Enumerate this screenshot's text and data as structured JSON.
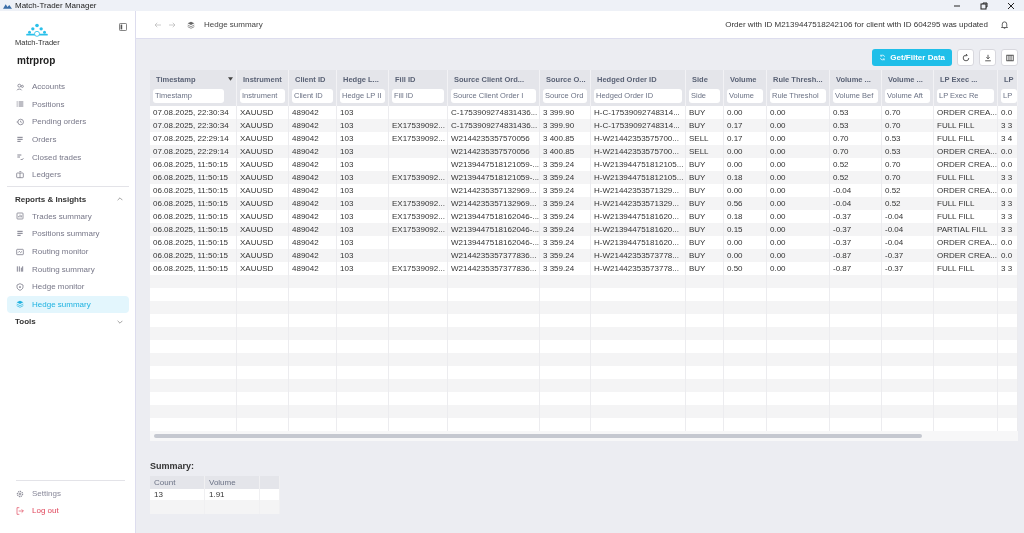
{
  "window": {
    "title": "Match-Trader Manager"
  },
  "sidebar": {
    "logo_text": "Match-Trader",
    "account": "mtrprop",
    "items": [
      {
        "label": "Accounts",
        "selected": false
      },
      {
        "label": "Positions",
        "selected": false
      },
      {
        "label": "Pending orders",
        "selected": false
      },
      {
        "label": "Orders",
        "selected": false
      },
      {
        "label": "Closed trades",
        "selected": false
      },
      {
        "label": "Ledgers",
        "selected": false
      }
    ],
    "sections": [
      {
        "label": "Reports & Insights",
        "expanded": true,
        "children": [
          {
            "label": "Trades summary",
            "selected": false
          },
          {
            "label": "Positions summary",
            "selected": false
          },
          {
            "label": "Routing monitor",
            "selected": false
          },
          {
            "label": "Routing summary",
            "selected": false
          },
          {
            "label": "Hedge monitor",
            "selected": false
          },
          {
            "label": "Hedge summary",
            "selected": true
          }
        ]
      },
      {
        "label": "Tools",
        "expanded": false
      }
    ],
    "footer": [
      {
        "label": "Settings",
        "kind": "settings"
      },
      {
        "label": "Log out",
        "kind": "logout"
      }
    ]
  },
  "topbar": {
    "breadcrumb": "Hedge summary",
    "notification": "Order with ID M2139447518242106 for client with ID 604295 was updated"
  },
  "toolbar": {
    "primary_button": "Get/Filter Data"
  },
  "table": {
    "columns": [
      {
        "label": "Timestamp",
        "placeholder": "Timestamp",
        "sorted": true
      },
      {
        "label": "Instrument",
        "placeholder": "Instrument",
        "sorted": false
      },
      {
        "label": "Client ID",
        "placeholder": "Client ID",
        "sorted": false
      },
      {
        "label": "Hedge L...",
        "placeholder": "Hedge LP II",
        "sorted": false
      },
      {
        "label": "Fill ID",
        "placeholder": "Fill ID",
        "sorted": false
      },
      {
        "label": "Source Client Ord...",
        "placeholder": "Source Client Order I",
        "sorted": false
      },
      {
        "label": "Source O...",
        "placeholder": "Source Ord",
        "sorted": false
      },
      {
        "label": "Hedged Order ID",
        "placeholder": "Hedged Order ID",
        "sorted": false
      },
      {
        "label": "Side",
        "placeholder": "Side",
        "sorted": false
      },
      {
        "label": "Volume",
        "placeholder": "Volume",
        "sorted": false
      },
      {
        "label": "Rule Thresh...",
        "placeholder": "Rule Threshol",
        "sorted": false
      },
      {
        "label": "Volume ...",
        "placeholder": "Volume Bef",
        "sorted": false
      },
      {
        "label": "Volume ...",
        "placeholder": "Volume Aft",
        "sorted": false
      },
      {
        "label": "LP Exec ...",
        "placeholder": "LP Exec Re",
        "sorted": false
      },
      {
        "label": "LP",
        "placeholder": "LP",
        "sorted": false
      }
    ],
    "rows": [
      [
        "07.08.2025, 22:30:34",
        "XAUUSD",
        "489042",
        "103",
        null,
        "C-1753909274831436...",
        "3 399.90",
        "H-C-17539092748314...",
        "BUY",
        "0.00",
        "0.00",
        "0.53",
        "0.70",
        "ORDER CREA...",
        "0.0"
      ],
      [
        "07.08.2025, 22:30:34",
        "XAUUSD",
        "489042",
        "103",
        "EX17539092...",
        "C-1753909274831436...",
        "3 399.90",
        "H-C-17539092748314...",
        "BUY",
        "0.17",
        "0.00",
        "0.53",
        "0.70",
        "FULL FILL",
        "3 3"
      ],
      [
        "07.08.2025, 22:29:14",
        "XAUUSD",
        "489042",
        "103",
        "EX17539092...",
        "W2144235357570056",
        "3 400.85",
        "H-W21442353575700...",
        "SELL",
        "0.17",
        "0.00",
        "0.70",
        "0.53",
        "FULL FILL",
        "3 4"
      ],
      [
        "07.08.2025, 22:29:14",
        "XAUUSD",
        "489042",
        "103",
        null,
        "W2144235357570056",
        "3 400.85",
        "H-W21442353575700...",
        "SELL",
        "0.00",
        "0.00",
        "0.70",
        "0.53",
        "ORDER CREA...",
        "0.0"
      ],
      [
        "06.08.2025, 11:50:15",
        "XAUUSD",
        "489042",
        "103",
        null,
        "W2139447518121059-...",
        "3 359.24",
        "H-W213944751812105...",
        "BUY",
        "0.00",
        "0.00",
        "0.52",
        "0.70",
        "ORDER CREA...",
        "0.0"
      ],
      [
        "06.08.2025, 11:50:15",
        "XAUUSD",
        "489042",
        "103",
        "EX17539092...",
        "W2139447518121059-...",
        "3 359.24",
        "H-W213944751812105...",
        "BUY",
        "0.18",
        "0.00",
        "0.52",
        "0.70",
        "FULL FILL",
        "3 3"
      ],
      [
        "06.08.2025, 11:50:15",
        "XAUUSD",
        "489042",
        "103",
        null,
        "W2144235357132969...",
        "3 359.24",
        "H-W21442353571329...",
        "BUY",
        "0.00",
        "0.00",
        "-0.04",
        "0.52",
        "ORDER CREA...",
        "0.0"
      ],
      [
        "06.08.2025, 11:50:15",
        "XAUUSD",
        "489042",
        "103",
        "EX17539092...",
        "W2144235357132969...",
        "3 359.24",
        "H-W21442353571329...",
        "BUY",
        "0.56",
        "0.00",
        "-0.04",
        "0.52",
        "FULL FILL",
        "3 3"
      ],
      [
        "06.08.2025, 11:50:15",
        "XAUUSD",
        "489042",
        "103",
        "EX17539092...",
        "W2139447518162046-...",
        "3 359.24",
        "H-W21394475181620...",
        "BUY",
        "0.18",
        "0.00",
        "-0.37",
        "-0.04",
        "FULL FILL",
        "3 3"
      ],
      [
        "06.08.2025, 11:50:15",
        "XAUUSD",
        "489042",
        "103",
        "EX17539092...",
        "W2139447518162046-...",
        "3 359.24",
        "H-W21394475181620...",
        "BUY",
        "0.15",
        "0.00",
        "-0.37",
        "-0.04",
        "PARTIAL FILL",
        "3 3"
      ],
      [
        "06.08.2025, 11:50:15",
        "XAUUSD",
        "489042",
        "103",
        null,
        "W2139447518162046-...",
        "3 359.24",
        "H-W21394475181620...",
        "BUY",
        "0.00",
        "0.00",
        "-0.37",
        "-0.04",
        "ORDER CREA...",
        "0.0"
      ],
      [
        "06.08.2025, 11:50:15",
        "XAUUSD",
        "489042",
        "103",
        null,
        "W2144235357377836...",
        "3 359.24",
        "H-W21442353573778...",
        "BUY",
        "0.00",
        "0.00",
        "-0.87",
        "-0.37",
        "ORDER CREA...",
        "0.0"
      ],
      [
        "06.08.2025, 11:50:15",
        "XAUUSD",
        "489042",
        "103",
        "EX17539092...",
        "W2144235357377836...",
        "3 359.24",
        "H-W21442353573778...",
        "BUY",
        "0.50",
        "0.00",
        "-0.87",
        "-0.37",
        "FULL FILL",
        "3 3"
      ]
    ]
  },
  "summary": {
    "title": "Summary:",
    "columns": [
      "Count",
      "Volume"
    ],
    "rows": [
      [
        "13",
        "1.91"
      ]
    ]
  }
}
